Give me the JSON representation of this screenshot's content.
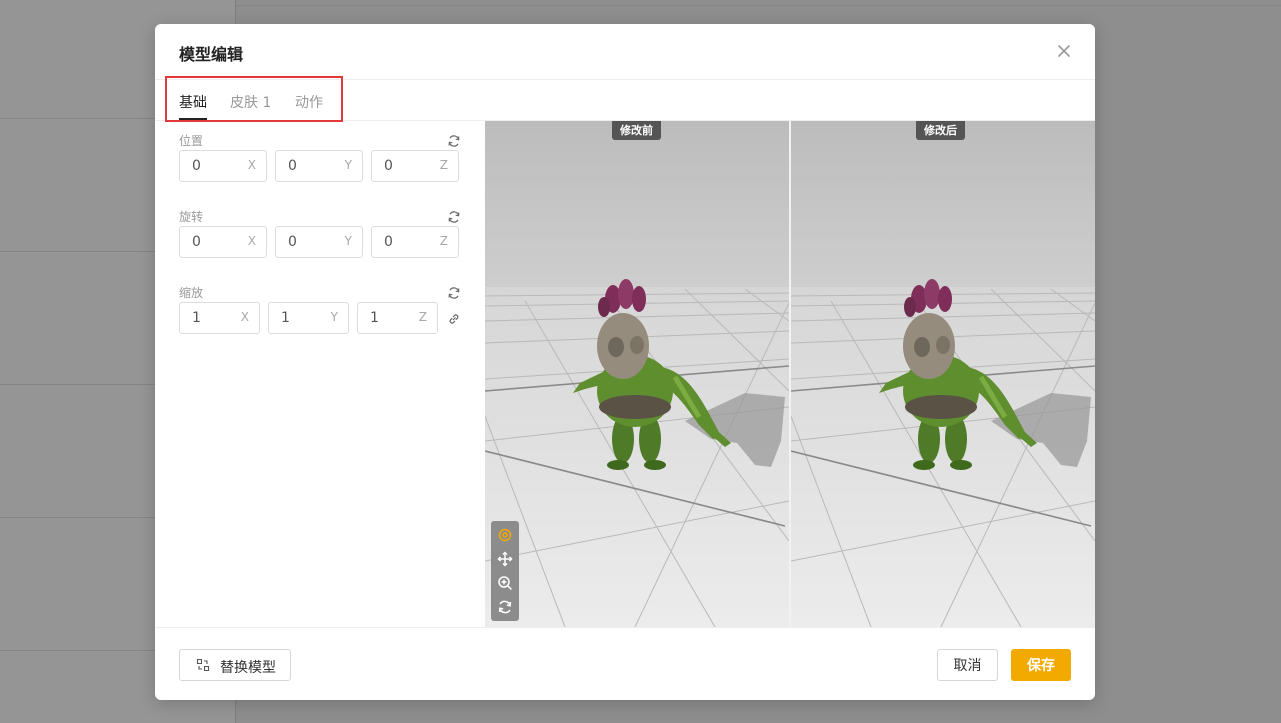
{
  "modal": {
    "title": "模型编辑"
  },
  "tabs": [
    {
      "label": "基础",
      "active": true
    },
    {
      "label": "皮肤 1",
      "active": false
    },
    {
      "label": "动作",
      "active": false
    }
  ],
  "groups": {
    "position": {
      "label": "位置",
      "fields": [
        {
          "value": "0",
          "axis": "X"
        },
        {
          "value": "0",
          "axis": "Y"
        },
        {
          "value": "0",
          "axis": "Z"
        }
      ]
    },
    "rotation": {
      "label": "旋转",
      "fields": [
        {
          "value": "0",
          "axis": "X"
        },
        {
          "value": "0",
          "axis": "Y"
        },
        {
          "value": "0",
          "axis": "Z"
        }
      ]
    },
    "scale": {
      "label": "缩放",
      "fields": [
        {
          "value": "1",
          "axis": "X"
        },
        {
          "value": "1",
          "axis": "Y"
        },
        {
          "value": "1",
          "axis": "Z"
        }
      ]
    }
  },
  "preview": {
    "before_label": "修改前",
    "after_label": "修改后"
  },
  "footer": {
    "replace_label": "替换模型",
    "cancel_label": "取消",
    "save_label": "保存"
  },
  "colors": {
    "accent": "#f2a900",
    "highlight_border": "#e03a3a",
    "badge_bg": "#555555"
  },
  "icons": {
    "close": "close-icon",
    "reset": "refresh-icon",
    "link": "link-icon",
    "replace": "swap-icon",
    "tools": [
      "target-icon",
      "move-icon",
      "zoom-in-icon",
      "rotate-icon"
    ]
  }
}
